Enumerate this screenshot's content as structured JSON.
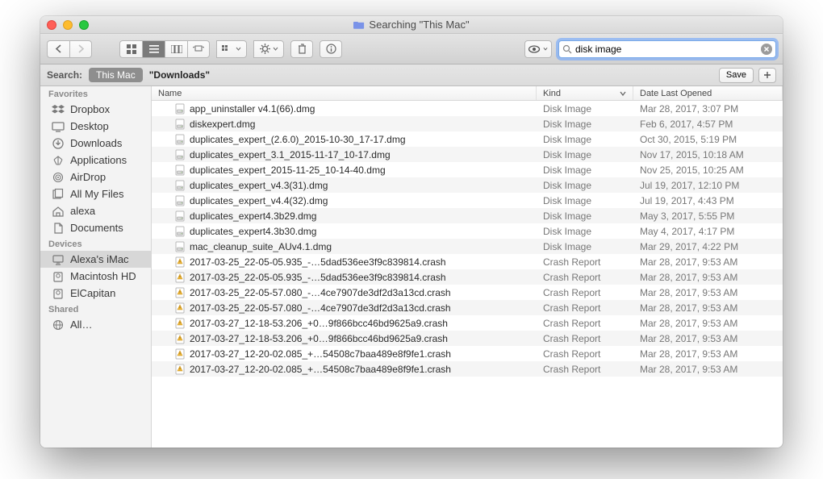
{
  "window": {
    "title_prefix": "Searching",
    "title_quoted": "\"This Mac\""
  },
  "search": {
    "value": "disk image"
  },
  "scope": {
    "label": "Search:",
    "active": "This Mac",
    "other": "\"Downloads\"",
    "save": "Save"
  },
  "sidebar": {
    "sections": [
      {
        "title": "Favorites",
        "items": [
          {
            "icon": "dropbox",
            "label": "Dropbox"
          },
          {
            "icon": "desktop",
            "label": "Desktop"
          },
          {
            "icon": "downloads",
            "label": "Downloads"
          },
          {
            "icon": "apps",
            "label": "Applications"
          },
          {
            "icon": "airdrop",
            "label": "AirDrop"
          },
          {
            "icon": "allfiles",
            "label": "All My Files"
          },
          {
            "icon": "home",
            "label": "alexa"
          },
          {
            "icon": "documents",
            "label": "Documents"
          }
        ]
      },
      {
        "title": "Devices",
        "items": [
          {
            "icon": "imac",
            "label": "Alexa's iMac",
            "selected": true
          },
          {
            "icon": "disk",
            "label": "Macintosh HD"
          },
          {
            "icon": "disk",
            "label": "ElCapitan"
          }
        ]
      },
      {
        "title": "Shared",
        "items": [
          {
            "icon": "network",
            "label": "All…"
          }
        ]
      }
    ]
  },
  "columns": {
    "name": "Name",
    "kind": "Kind",
    "date": "Date Last Opened"
  },
  "files": [
    {
      "icon": "dmg",
      "name": "app_uninstaller v4.1(66).dmg",
      "kind": "Disk Image",
      "date": "Mar 28, 2017, 3:07 PM"
    },
    {
      "icon": "dmg",
      "name": "diskexpert.dmg",
      "kind": "Disk Image",
      "date": "Feb 6, 2017, 4:57 PM"
    },
    {
      "icon": "dmg",
      "name": "duplicates_expert_(2.6.0)_2015-10-30_17-17.dmg",
      "kind": "Disk Image",
      "date": "Oct 30, 2015, 5:19 PM"
    },
    {
      "icon": "dmg",
      "name": "duplicates_expert_3.1_2015-11-17_10-17.dmg",
      "kind": "Disk Image",
      "date": "Nov 17, 2015, 10:18 AM"
    },
    {
      "icon": "dmg",
      "name": "duplicates_expert_2015-11-25_10-14-40.dmg",
      "kind": "Disk Image",
      "date": "Nov 25, 2015, 10:25 AM"
    },
    {
      "icon": "dmg",
      "name": "duplicates_expert_v4.3(31).dmg",
      "kind": "Disk Image",
      "date": "Jul 19, 2017, 12:10 PM"
    },
    {
      "icon": "dmg",
      "name": "duplicates_expert_v4.4(32).dmg",
      "kind": "Disk Image",
      "date": "Jul 19, 2017, 4:43 PM"
    },
    {
      "icon": "dmg",
      "name": "duplicates_expert4.3b29.dmg",
      "kind": "Disk Image",
      "date": "May 3, 2017, 5:55 PM"
    },
    {
      "icon": "dmg",
      "name": "duplicates_expert4.3b30.dmg",
      "kind": "Disk Image",
      "date": "May 4, 2017, 4:17 PM"
    },
    {
      "icon": "dmg",
      "name": "mac_cleanup_suite_AUv4.1.dmg",
      "kind": "Disk Image",
      "date": "Mar 29, 2017, 4:22 PM"
    },
    {
      "icon": "crash",
      "name": "2017-03-25_22-05-05.935_-…5dad536ee3f9c839814.crash",
      "kind": "Crash Report",
      "date": "Mar 28, 2017, 9:53 AM"
    },
    {
      "icon": "crash",
      "name": "2017-03-25_22-05-05.935_-…5dad536ee3f9c839814.crash",
      "kind": "Crash Report",
      "date": "Mar 28, 2017, 9:53 AM"
    },
    {
      "icon": "crash",
      "name": "2017-03-25_22-05-57.080_-…4ce7907de3df2d3a13cd.crash",
      "kind": "Crash Report",
      "date": "Mar 28, 2017, 9:53 AM"
    },
    {
      "icon": "crash",
      "name": "2017-03-25_22-05-57.080_-…4ce7907de3df2d3a13cd.crash",
      "kind": "Crash Report",
      "date": "Mar 28, 2017, 9:53 AM"
    },
    {
      "icon": "crash",
      "name": "2017-03-27_12-18-53.206_+0…9f866bcc46bd9625a9.crash",
      "kind": "Crash Report",
      "date": "Mar 28, 2017, 9:53 AM"
    },
    {
      "icon": "crash",
      "name": "2017-03-27_12-18-53.206_+0…9f866bcc46bd9625a9.crash",
      "kind": "Crash Report",
      "date": "Mar 28, 2017, 9:53 AM"
    },
    {
      "icon": "crash",
      "name": "2017-03-27_12-20-02.085_+…54508c7baa489e8f9fe1.crash",
      "kind": "Crash Report",
      "date": "Mar 28, 2017, 9:53 AM"
    },
    {
      "icon": "crash",
      "name": "2017-03-27_12-20-02.085_+…54508c7baa489e8f9fe1.crash",
      "kind": "Crash Report",
      "date": "Mar 28, 2017, 9:53 AM"
    }
  ]
}
